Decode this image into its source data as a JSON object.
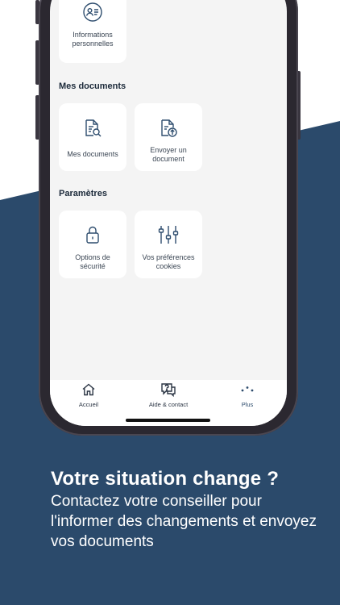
{
  "colors": {
    "navy": "#2b4a6b",
    "card_bg": "#ffffff",
    "screen_bg": "#f4f4f4"
  },
  "cards": {
    "infos": {
      "label": "Informations personnelles",
      "icon": "id-card-icon"
    },
    "mes_documents": {
      "label": "Mes documents",
      "icon": "document-search-icon"
    },
    "envoyer": {
      "label": "Envoyer un document",
      "icon": "document-upload-icon"
    },
    "securite": {
      "label": "Options de sécurité",
      "icon": "lock-icon"
    },
    "cookies": {
      "label": "Vos préférences cookies",
      "icon": "sliders-icon"
    }
  },
  "sections": {
    "documents": "Mes documents",
    "parametres": "Paramètres"
  },
  "tabbar": {
    "accueil": "Accueil",
    "aide": "Aide & contact",
    "plus": "Plus"
  },
  "caption": {
    "headline": "Votre situation change ?",
    "body": "Contactez votre conseiller pour l'informer des changements et envoyez vos documents"
  }
}
